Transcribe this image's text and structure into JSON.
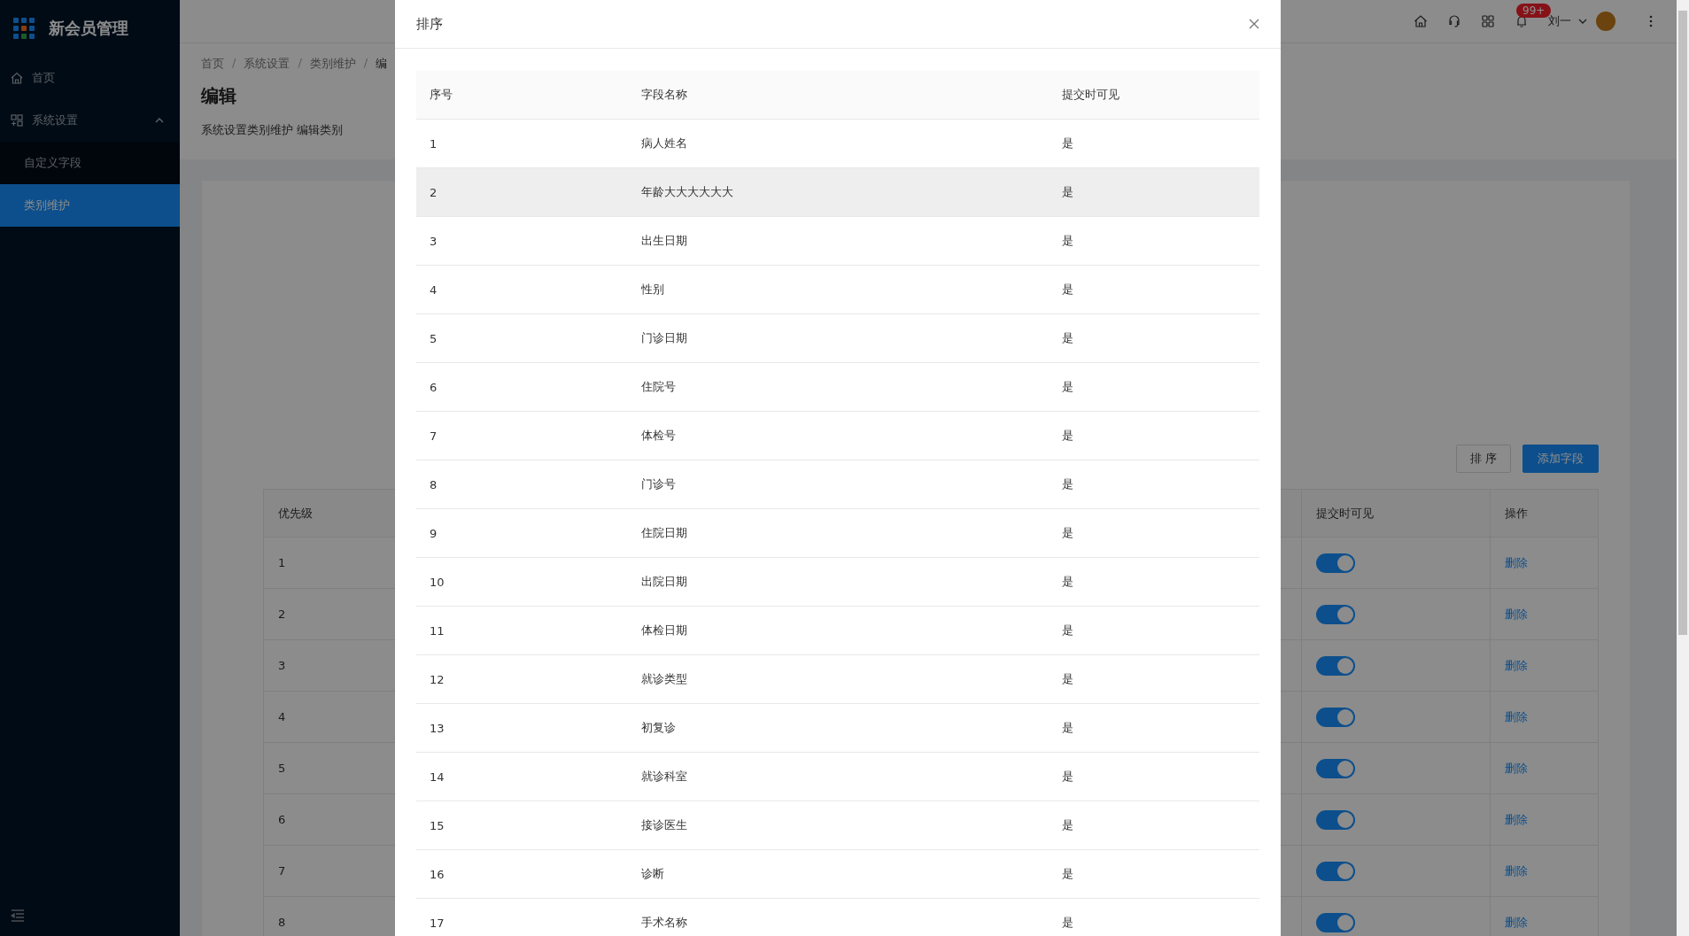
{
  "sidebar": {
    "app_title": "新会员管理",
    "items": [
      {
        "kind": "page",
        "label": "首页",
        "selected": false
      },
      {
        "kind": "group",
        "label": "系统设置",
        "expanded": true,
        "children": [
          {
            "label": "自定义字段",
            "selected": false
          },
          {
            "label": "类别维护",
            "selected": true
          }
        ]
      }
    ]
  },
  "header": {
    "notification_badge": "99+",
    "user_name": "刘一"
  },
  "breadcrumb": [
    {
      "kind": "link",
      "text": "首页"
    },
    {
      "kind": "separator",
      "text": "/"
    },
    {
      "kind": "link",
      "text": "系统设置"
    },
    {
      "kind": "separator",
      "text": "/"
    },
    {
      "kind": "link",
      "text": "类别维护"
    },
    {
      "kind": "separator",
      "text": "/"
    },
    {
      "kind": "current",
      "text": "编"
    }
  ],
  "page": {
    "title": "编辑",
    "subtitle": "系统设置类别维护 编辑类别"
  },
  "toolbar": {
    "buttons": [
      {
        "kind": "default",
        "label": "排 序"
      },
      {
        "kind": "primary",
        "label": "添加字段"
      }
    ]
  },
  "table": {
    "columns": [
      "优先级",
      "提交时可见",
      "操作"
    ],
    "rows": [
      {
        "priority": "1",
        "visible_on_submit": true,
        "action": "删除"
      },
      {
        "priority": "2",
        "visible_on_submit": true,
        "action": "删除"
      },
      {
        "priority": "3",
        "visible_on_submit": true,
        "action": "删除"
      },
      {
        "priority": "4",
        "visible_on_submit": true,
        "action": "删除"
      },
      {
        "priority": "5",
        "visible_on_submit": true,
        "action": "删除"
      },
      {
        "priority": "6",
        "visible_on_submit": true,
        "action": "删除"
      },
      {
        "priority": "7",
        "visible_on_submit": true,
        "action": "删除"
      },
      {
        "priority": "8",
        "visible_on_submit": true,
        "action": "删除"
      }
    ]
  },
  "modal": {
    "title": "排序",
    "columns": [
      "序号",
      "字段名称",
      "提交时可见"
    ],
    "rows": [
      {
        "index": "1",
        "field": "病人姓名",
        "visible": "是",
        "highlighted": false
      },
      {
        "index": "2",
        "field": "年龄大大大大大大",
        "visible": "是",
        "highlighted": true
      },
      {
        "index": "3",
        "field": "出生日期",
        "visible": "是",
        "highlighted": false
      },
      {
        "index": "4",
        "field": "性别",
        "visible": "是",
        "highlighted": false
      },
      {
        "index": "5",
        "field": "门诊日期",
        "visible": "是",
        "highlighted": false
      },
      {
        "index": "6",
        "field": "住院号",
        "visible": "是",
        "highlighted": false
      },
      {
        "index": "7",
        "field": "体检号",
        "visible": "是",
        "highlighted": false
      },
      {
        "index": "8",
        "field": "门诊号",
        "visible": "是",
        "highlighted": false
      },
      {
        "index": "9",
        "field": "住院日期",
        "visible": "是",
        "highlighted": false
      },
      {
        "index": "10",
        "field": "出院日期",
        "visible": "是",
        "highlighted": false
      },
      {
        "index": "11",
        "field": "体检日期",
        "visible": "是",
        "highlighted": false
      },
      {
        "index": "12",
        "field": "就诊类型",
        "visible": "是",
        "highlighted": false
      },
      {
        "index": "13",
        "field": "初复诊",
        "visible": "是",
        "highlighted": false
      },
      {
        "index": "14",
        "field": "就诊科室",
        "visible": "是",
        "highlighted": false
      },
      {
        "index": "15",
        "field": "接诊医生",
        "visible": "是",
        "highlighted": false
      },
      {
        "index": "16",
        "field": "诊断",
        "visible": "是",
        "highlighted": false
      },
      {
        "index": "17",
        "field": "手术名称",
        "visible": "是",
        "highlighted": false
      }
    ]
  }
}
